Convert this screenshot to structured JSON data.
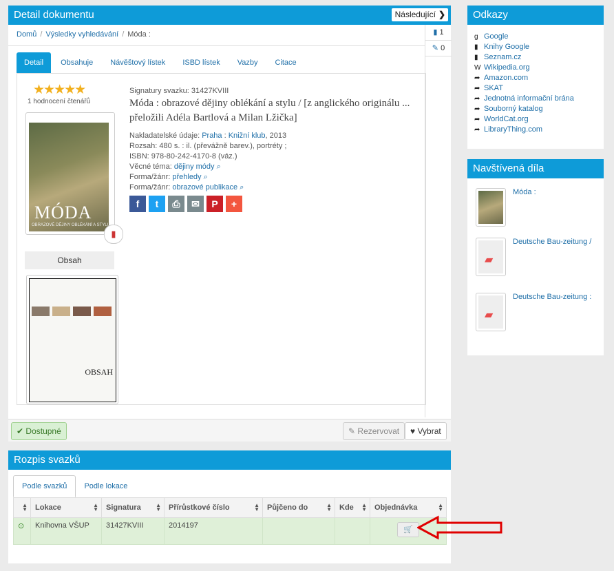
{
  "detail": {
    "title": "Detail dokumentu",
    "next_label": "Následující",
    "breadcrumb": [
      "Domů",
      "Výsledky vyhledávání",
      "Móda :"
    ],
    "counts": [
      "1",
      "0"
    ],
    "tabs": [
      "Detail",
      "Obsahuje",
      "Návěštový lístek",
      "ISBD lístek",
      "Vazby",
      "Citace"
    ],
    "rating_text": "1 hodnocení čtenářů",
    "cover_title": "MÓDA",
    "cover_subtitle": "OBRAZOVÉ DĚJINY OBLÉKÁNÍ A STYLU",
    "obsah_label": "Obsah",
    "obsah_cover_text": "OBSAH",
    "signature": "Signatury svazku: 31427KVIII",
    "book_title": "Móda : obrazové dějiny oblékání a stylu / [z anglického originálu ... přeložili Adéla Bartlová a Milan Lžička]",
    "publisher_label": "Nakladatelské údaje:",
    "publisher_place": "Praha",
    "publisher_name": "Knižní klub",
    "publisher_year": ", 2013",
    "extent": "Rozsah: 480 s. : il. (převážně barev.), portréty ;",
    "isbn": "ISBN: 978-80-242-4170-8 (váz.)",
    "subject_label": "Věcné téma:",
    "subject_value": "dějiny módy",
    "genre1_label": "Forma/žánr:",
    "genre1_value": "přehledy",
    "genre2_label": "Forma/žánr:",
    "genre2_value": "obrazové publikace",
    "share_icons": [
      "facebook-icon",
      "twitter-icon",
      "print-icon",
      "email-icon",
      "pinterest-icon",
      "plus-icon"
    ],
    "available_label": "Dostupné",
    "reserve_label": "Rezervovat",
    "pick_label": "Vybrat"
  },
  "odkazy": {
    "title": "Odkazy",
    "links": [
      "Google",
      "Knihy Google",
      "Seznam.cz",
      "Wikipedia.org",
      "Amazon.com",
      "SKAT",
      "Jednotná informační brána",
      "Souborný katalog",
      "WorldCat.org",
      "LibraryThing.com"
    ]
  },
  "visited": {
    "title": "Navštívená díla",
    "items": [
      "Móda :",
      "Deutsche Bau-zeitung /",
      "Deutsche Bau-zeitung :"
    ]
  },
  "rozpis": {
    "title": "Rozpis svazků",
    "tabs": [
      "Podle svazků",
      "Podle lokace"
    ],
    "columns": [
      "Lokace",
      "Signatura",
      "Přírůstkové číslo",
      "Půjčeno do",
      "Kde",
      "Objednávka"
    ],
    "rows": [
      {
        "lokace": "Knihovna VŠUP",
        "signatura": "31427KVIII",
        "cislo": "2014197",
        "pujceno": "",
        "kde": ""
      }
    ]
  },
  "colors": {
    "accent": "#0e9bd8",
    "available": "#dff0d8",
    "arrow": "#e00000"
  }
}
